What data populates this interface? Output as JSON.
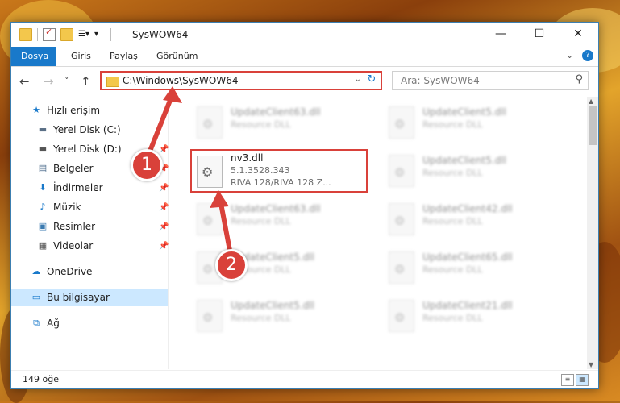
{
  "window": {
    "title": "SysWOW64",
    "controls": {
      "minimize": "—",
      "maximize": "☐",
      "close": "✕"
    }
  },
  "ribbon": {
    "tabs": [
      "Dosya",
      "Giriş",
      "Paylaş",
      "Görünüm"
    ],
    "expand_icon": "chevron-down-icon",
    "help_label": "?"
  },
  "navigation": {
    "back": "←",
    "forward": "→",
    "recent": "˅",
    "up": "↑",
    "address": "C:\\Windows\\SysWOW64",
    "refresh": "↻",
    "search_placeholder": "Ara: SysWOW64"
  },
  "sidebar": {
    "items": [
      {
        "label": "Hızlı erişim",
        "icon": "star-icon"
      },
      {
        "label": "Yerel Disk (C:)",
        "icon": "drive-icon"
      },
      {
        "label": "Yerel Disk (D:)",
        "icon": "drive-icon"
      },
      {
        "label": "Belgeler",
        "icon": "documents-icon"
      },
      {
        "label": "İndirmeler",
        "icon": "download-icon"
      },
      {
        "label": "Müzik",
        "icon": "music-icon"
      },
      {
        "label": "Resimler",
        "icon": "pictures-icon"
      },
      {
        "label": "Videolar",
        "icon": "video-icon"
      },
      {
        "label": "OneDrive",
        "icon": "cloud-icon"
      },
      {
        "label": "Bu bilgisayar",
        "icon": "computer-icon"
      },
      {
        "label": "Ağ",
        "icon": "network-icon"
      }
    ],
    "pin_glyph": "📌"
  },
  "files": {
    "focused": {
      "name": "nv3.dll",
      "version": "5.1.3528.343",
      "description": "RIVA 128/RIVA 128 Z..."
    },
    "background": [
      {
        "name": "UpdateClient63.dll",
        "desc": "Resource DLL"
      },
      {
        "name": "UpdateClient5.dll",
        "desc": "Resource DLL"
      },
      {
        "name": "UpdateClient5.dll",
        "desc": "Resource DLL"
      },
      {
        "name": "UpdateClient63.dll",
        "desc": "Resource DLL"
      },
      {
        "name": "UpdateClient42.dll",
        "desc": "Resource DLL"
      },
      {
        "name": "UpdateClient5.dll",
        "desc": "Resource DLL"
      },
      {
        "name": "UpdateClient65.dll",
        "desc": "Resource DLL"
      },
      {
        "name": "UpdateClient5.dll",
        "desc": "Resource DLL"
      },
      {
        "name": "UpdateClient21.dll",
        "desc": "Resource DLL"
      }
    ]
  },
  "status": {
    "item_count": "149 öğe"
  },
  "annotations": {
    "step1": "1",
    "step2": "2",
    "accent": "#d9413a"
  }
}
